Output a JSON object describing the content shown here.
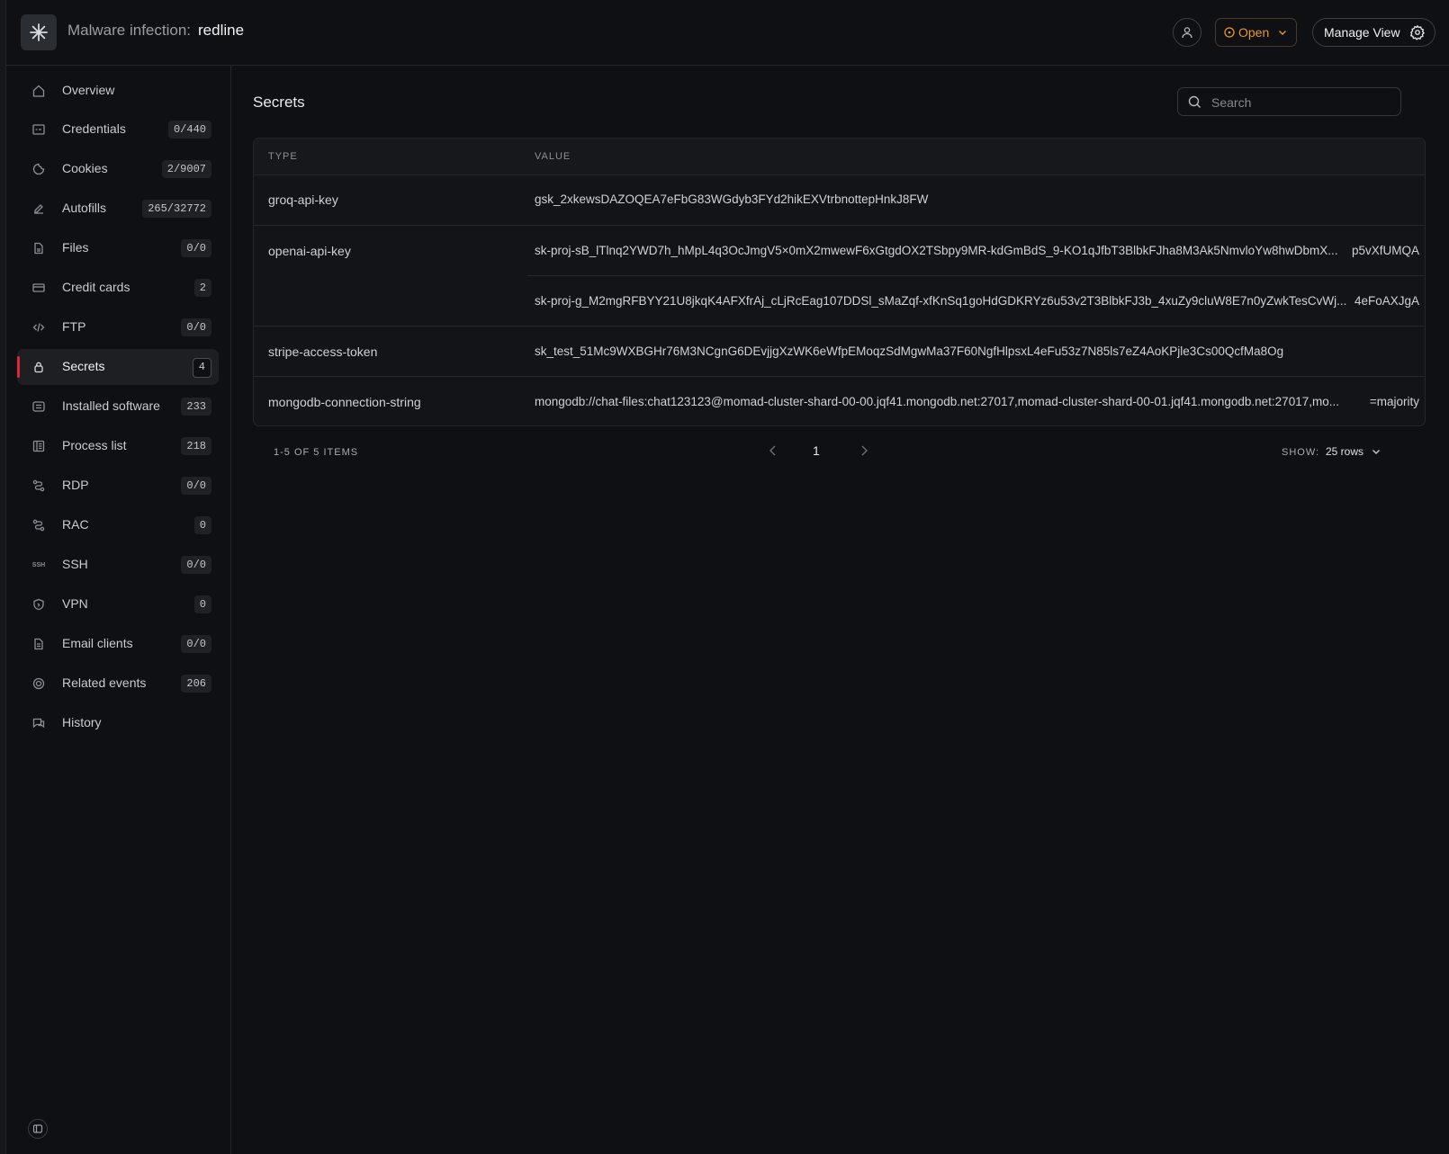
{
  "header": {
    "title_prefix": "Malware infection:",
    "title_name": "redline",
    "status_label": "Open",
    "manage_label": "Manage View",
    "status_color": "#e8962e"
  },
  "sidebar": {
    "items": [
      {
        "label": "Overview",
        "badge": "",
        "icon": "home-icon"
      },
      {
        "label": "Credentials",
        "badge": "0/440",
        "icon": "credentials-icon"
      },
      {
        "label": "Cookies",
        "badge": "2/9007",
        "icon": "cookie-icon"
      },
      {
        "label": "Autofills",
        "badge": "265/32772",
        "icon": "autofill-icon"
      },
      {
        "label": "Files",
        "badge": "0/0",
        "icon": "file-icon"
      },
      {
        "label": "Credit cards",
        "badge": "2",
        "icon": "credit-card-icon"
      },
      {
        "label": "FTP",
        "badge": "0/0",
        "icon": "code-icon"
      },
      {
        "label": "Secrets",
        "badge": "4",
        "icon": "lock-icon",
        "active": true
      },
      {
        "label": "Installed software",
        "badge": "233",
        "icon": "software-icon"
      },
      {
        "label": "Process list",
        "badge": "218",
        "icon": "process-list-icon"
      },
      {
        "label": "RDP",
        "badge": "0/0",
        "icon": "rdp-icon"
      },
      {
        "label": "RAC",
        "badge": "0",
        "icon": "rac-icon"
      },
      {
        "label": "SSH",
        "badge": "0/0",
        "icon": "ssh-icon",
        "icon_text": "SSH"
      },
      {
        "label": "VPN",
        "badge": "0",
        "icon": "shield-icon"
      },
      {
        "label": "Email clients",
        "badge": "0/0",
        "icon": "email-file-icon"
      },
      {
        "label": "Related events",
        "badge": "206",
        "icon": "target-icon"
      },
      {
        "label": "History",
        "badge": "",
        "icon": "history-icon"
      }
    ],
    "accent_color": "#e0243a"
  },
  "main": {
    "title": "Secrets",
    "search_placeholder": "Search",
    "columns": [
      "TYPE",
      "VALUE"
    ],
    "rows": [
      {
        "type": "groq-api-key",
        "values": [
          {
            "text": "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",
            "tail": ""
          }
        ]
      },
      {
        "type": "openai-api-key",
        "values": [
          {
            "text": "sk-proj-sB_lTlnq2YWD7h_hMpL4q3OcJmgV5×0mX2mwewF6xGtgdOX2TSbpy9MR-kdGmBdS_9-KO1qJfbT3BlbkFJha8M3Ak5NmvloYw8hwDbmX...",
            "tail": "p5vXfUMQA"
          },
          {
            "text": "sk-proj-g_M2mgRFBYY21U8jkqK4AFXfrAj_cLjRcEag107DDSl_sMaZqf-xfKnSq1goHdGDKRYz6u53v2T3BlbkFJ3b_4xuZy9cluW8E7n0yZwkTesCvWj...",
            "tail": "4eFoAXJgA"
          }
        ]
      },
      {
        "type": "stripe-access-token",
        "values": [
          {
            "text": "sk_test_51Mc9WXBGHr76M3NCgnG6DEvjjgXzWK6eWfpEMoqzSdMgwMa37F60NgfHlpsxL4eFu53z7N85ls7eZ4AoKPjle3Cs00QcfMa8Og",
            "tail": ""
          }
        ]
      },
      {
        "type": "mongodb-connection-string",
        "values": [
          {
            "text": "mongodb://chat-files:chat123123@momad-cluster-shard-00-00.jqf41.mongodb.net:27017,momad-cluster-shard-00-01.jqf41.mongodb.net:27017,mo...",
            "tail": "=majority"
          }
        ]
      }
    ],
    "pagination": {
      "count_label": "1-5 OF 5 ITEMS",
      "page": "1",
      "show_label": "SHOW:",
      "rows_label": "25 rows"
    }
  }
}
